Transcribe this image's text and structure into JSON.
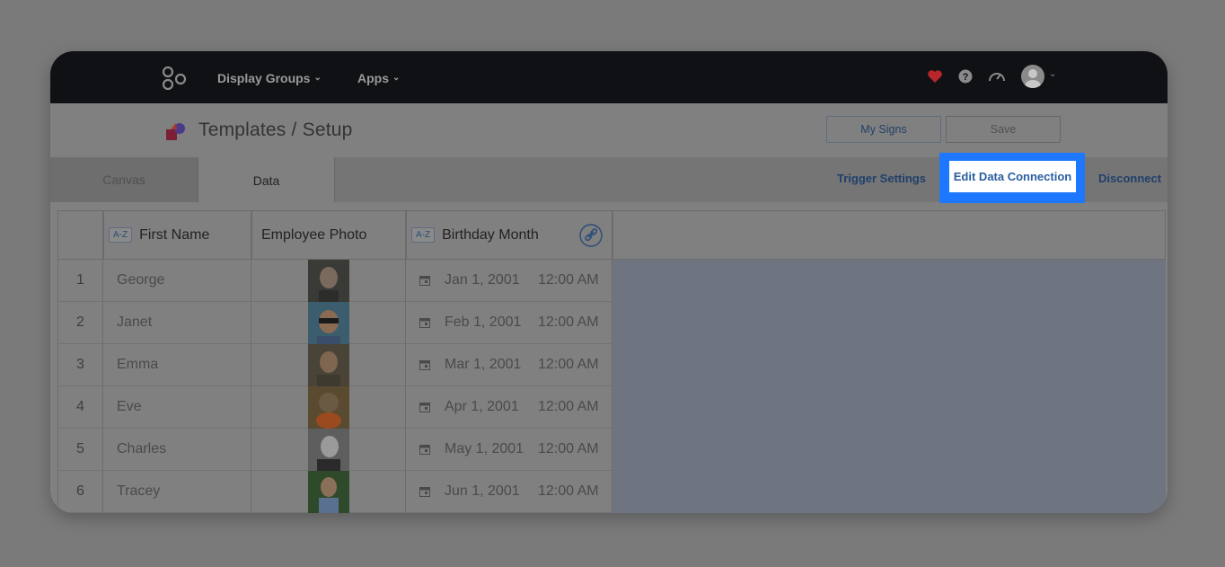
{
  "nav": {
    "items": [
      {
        "label": "Display Groups"
      },
      {
        "label": "Apps"
      }
    ]
  },
  "header": {
    "title": "Templates / Setup",
    "my_signs_label": "My Signs",
    "save_label": "Save"
  },
  "tabs": {
    "canvas_label": "Canvas",
    "data_label": "Data",
    "trigger_settings_label": "Trigger Settings",
    "edit_data_connection_label": "Edit Data Connection",
    "disconnect_label": "Disconnect"
  },
  "table": {
    "sort_badge": "A-Z",
    "columns": {
      "first_name": "First Name",
      "employee_photo": "Employee Photo",
      "birthday_month": "Birthday Month"
    },
    "rows": [
      {
        "num": "1",
        "name": "George",
        "date": "Jan 1, 2001",
        "time": "12:00 AM"
      },
      {
        "num": "2",
        "name": "Janet",
        "date": "Feb 1, 2001",
        "time": "12:00 AM"
      },
      {
        "num": "3",
        "name": "Emma",
        "date": "Mar 1, 2001",
        "time": "12:00 AM"
      },
      {
        "num": "4",
        "name": "Eve",
        "date": "Apr 1, 2001",
        "time": "12:00 AM"
      },
      {
        "num": "5",
        "name": "Charles",
        "date": "May 1, 2001",
        "time": "12:00 AM"
      },
      {
        "num": "6",
        "name": "Tracey",
        "date": "Jun 1, 2001",
        "time": "12:00 AM"
      }
    ]
  },
  "colors": {
    "highlight": "#1e78ff",
    "link": "#21406b",
    "topbar": "#101114",
    "heart": "#c0282f"
  }
}
